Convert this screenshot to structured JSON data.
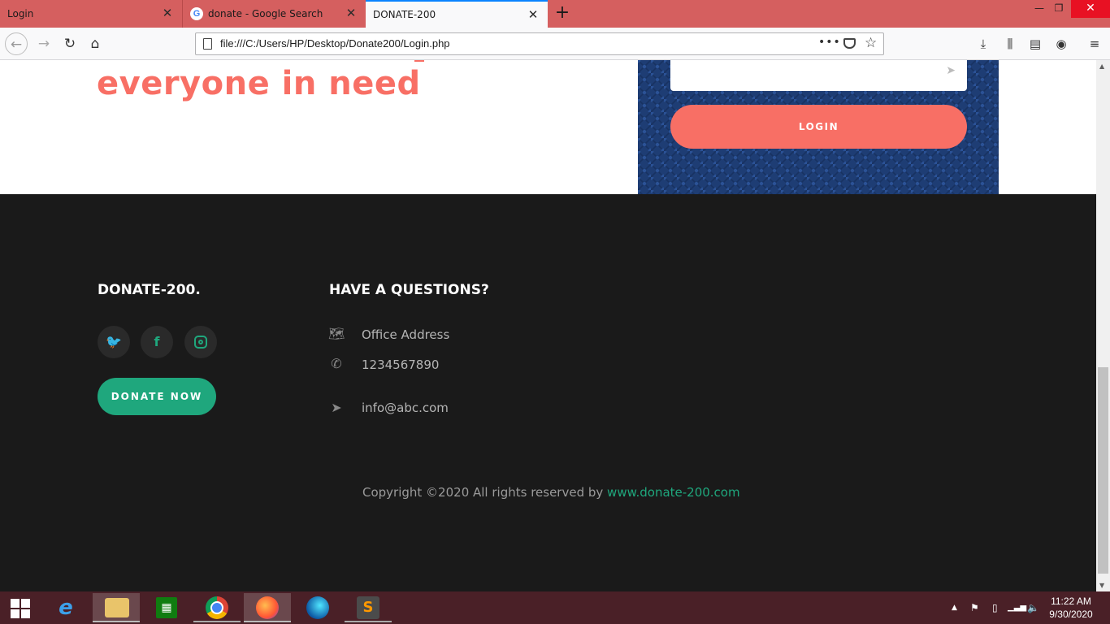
{
  "browser": {
    "tabs": [
      {
        "title": "Login",
        "active": false
      },
      {
        "title": "donate - Google Search",
        "active": false,
        "favicon": "google-icon"
      },
      {
        "title": "DONATE-200",
        "active": true
      }
    ],
    "new_tab_label": "+",
    "window_controls": {
      "minimize": "—",
      "maximize": "❐",
      "close": "✕"
    },
    "url": "file:///C:/Users/HP/Desktop/Donate200/Login.php",
    "page_actions": "•••",
    "accent_color": "#0a84ff",
    "tabbar_color": "#d55f5f"
  },
  "page": {
    "hero_title": "everyone in need",
    "hero_color": "#f86f65",
    "login": {
      "button_label": "LOGIN",
      "panel_color": "#1e3d74"
    },
    "footer": {
      "brand": "DONATE-200.",
      "social": [
        {
          "name": "twitter-icon",
          "glyph": "🐦"
        },
        {
          "name": "facebook-icon",
          "glyph": "f"
        },
        {
          "name": "instagram-icon",
          "glyph": ""
        }
      ],
      "donate_button": "DONATE NOW",
      "questions_title": "HAVE A QUESTIONS?",
      "contacts": [
        {
          "icon": "map-icon",
          "text": "Office Address"
        },
        {
          "icon": "phone-icon",
          "text": "1234567890"
        },
        {
          "icon": "paper-plane-icon",
          "text": "info@abc.com"
        }
      ],
      "copyright_prefix": "Copyright ©2020 All rights reserved by ",
      "copyright_link": "www.donate-200.com",
      "accent_color": "#1fa77d"
    }
  },
  "taskbar": {
    "apps": [
      {
        "name": "internet-explorer-icon"
      },
      {
        "name": "file-explorer-icon"
      },
      {
        "name": "store-icon"
      },
      {
        "name": "chrome-icon"
      },
      {
        "name": "firefox-icon"
      },
      {
        "name": "edge-icon"
      },
      {
        "name": "sublime-text-icon"
      }
    ],
    "time": "11:22 AM",
    "date": "9/30/2020"
  }
}
